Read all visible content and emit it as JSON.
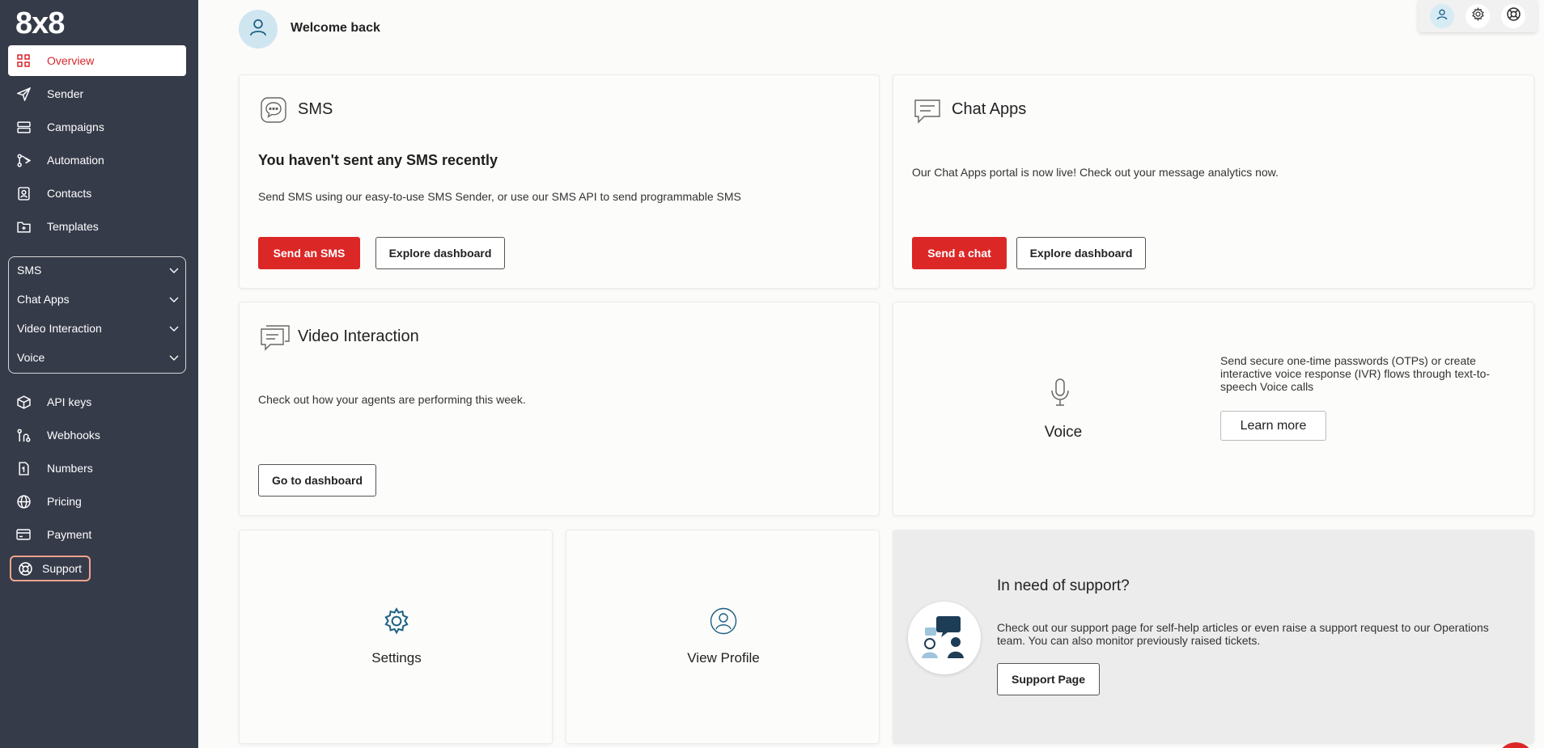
{
  "app": {
    "logo": "8x8"
  },
  "sidebar": {
    "items": [
      {
        "label": "Overview",
        "icon": "grid-icon"
      },
      {
        "label": "Sender",
        "icon": "send-icon"
      },
      {
        "label": "Campaigns",
        "icon": "campaigns-icon"
      },
      {
        "label": "Automation",
        "icon": "automation-icon"
      },
      {
        "label": "Contacts",
        "icon": "contacts-icon"
      },
      {
        "label": "Templates",
        "icon": "templates-icon"
      }
    ],
    "groups": [
      {
        "label": "SMS"
      },
      {
        "label": "Chat Apps"
      },
      {
        "label": "Video Interaction"
      },
      {
        "label": "Voice"
      }
    ],
    "bottom_items": [
      {
        "label": "API keys",
        "icon": "key-icon"
      },
      {
        "label": "Webhooks",
        "icon": "webhook-icon"
      },
      {
        "label": "Numbers",
        "icon": "numbers-icon"
      },
      {
        "label": "Pricing",
        "icon": "globe-icon"
      },
      {
        "label": "Payment",
        "icon": "card-icon"
      }
    ],
    "support": {
      "label": "Support",
      "icon": "support-icon"
    }
  },
  "header": {
    "welcome": "Welcome back"
  },
  "cards": {
    "sms": {
      "title": "SMS",
      "heading": "You haven't sent any SMS recently",
      "text": "Send SMS using our easy-to-use SMS Sender, or use our SMS API to send programmable SMS",
      "primary": "Send an SMS",
      "secondary": "Explore dashboard"
    },
    "chat": {
      "title": "Chat Apps",
      "text": "Our Chat Apps portal is now live! Check out your message analytics now.",
      "primary": "Send a chat",
      "secondary": "Explore dashboard"
    },
    "video": {
      "title": "Video Interaction",
      "text": "Check out how your agents are performing this week.",
      "button": "Go to dashboard"
    },
    "voice": {
      "label": "Voice",
      "text": "Send secure one-time passwords (OTPs) or create interactive voice response (IVR) flows through text-to-speech Voice calls",
      "button": "Learn more"
    },
    "settings": {
      "label": "Settings"
    },
    "profile": {
      "label": "View Profile"
    },
    "support": {
      "title": "In need of support?",
      "text": "Check out our support page for self-help articles or even raise a support request to our Operations team. You can also monitor previously raised tickets.",
      "button": "Support Page"
    }
  },
  "colors": {
    "accent": "#dc2727",
    "sidebar": "#363b4a"
  }
}
